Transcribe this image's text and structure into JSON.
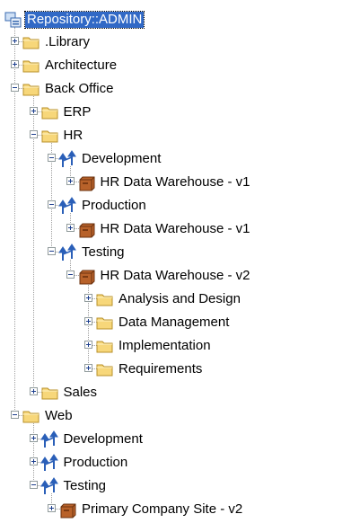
{
  "tree": {
    "nodes": [
      {
        "label": "Repository::ADMIN",
        "icon": "repository-icon",
        "selected": true
      },
      {
        "label": ".Library",
        "icon": "folder-icon",
        "toggle": "plus"
      },
      {
        "label": "Architecture",
        "icon": "folder-icon",
        "toggle": "plus"
      },
      {
        "label": "Back Office",
        "icon": "folder-icon",
        "toggle": "minus"
      },
      {
        "label": "ERP",
        "icon": "folder-icon",
        "toggle": "plus"
      },
      {
        "label": "HR",
        "icon": "folder-icon",
        "toggle": "minus"
      },
      {
        "label": "Development",
        "icon": "environment-icon",
        "toggle": "minus"
      },
      {
        "label": "HR Data Warehouse - v1",
        "icon": "package-icon",
        "toggle": "plus"
      },
      {
        "label": "Production",
        "icon": "environment-icon",
        "toggle": "minus"
      },
      {
        "label": "HR Data Warehouse - v1",
        "icon": "package-icon",
        "toggle": "plus"
      },
      {
        "label": "Testing",
        "icon": "environment-icon",
        "toggle": "minus"
      },
      {
        "label": "HR Data Warehouse - v2",
        "icon": "package-icon",
        "toggle": "minus"
      },
      {
        "label": "Analysis and Design",
        "icon": "folder-icon",
        "toggle": "plus"
      },
      {
        "label": "Data Management",
        "icon": "folder-icon",
        "toggle": "plus"
      },
      {
        "label": "Implementation",
        "icon": "folder-icon",
        "toggle": "plus"
      },
      {
        "label": "Requirements",
        "icon": "folder-icon",
        "toggle": "plus"
      },
      {
        "label": "Sales",
        "icon": "folder-icon",
        "toggle": "plus"
      },
      {
        "label": "Web",
        "icon": "folder-icon",
        "toggle": "minus"
      },
      {
        "label": "Development",
        "icon": "environment-icon",
        "toggle": "plus"
      },
      {
        "label": "Production",
        "icon": "environment-icon",
        "toggle": "plus"
      },
      {
        "label": "Testing",
        "icon": "environment-icon",
        "toggle": "minus"
      },
      {
        "label": "Primary Company Site - v2",
        "icon": "package-icon",
        "toggle": "plus"
      }
    ]
  },
  "colors": {
    "selection": "#3169c6",
    "folder_fill": "#f7d77a",
    "folder_edge": "#b8902a",
    "package_fill": "#b8622a",
    "environment_blue": "#2a5fb8"
  }
}
